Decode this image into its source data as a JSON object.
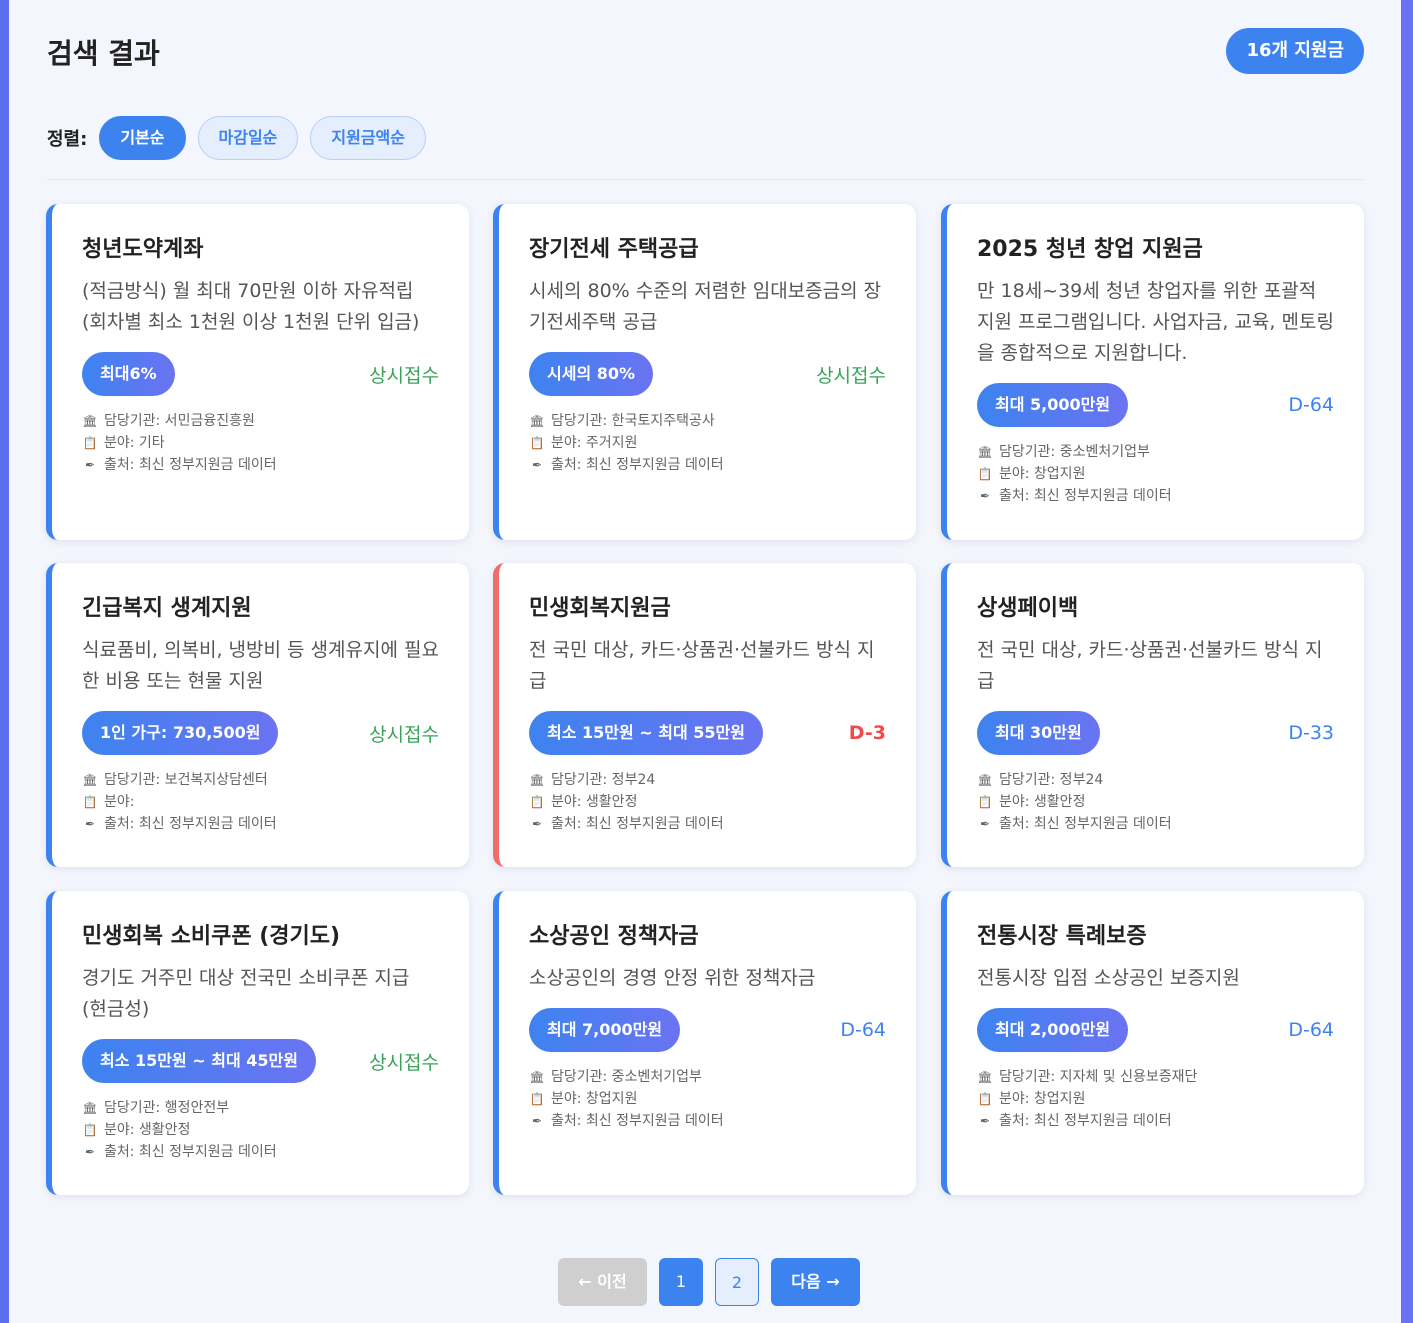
{
  "header": {
    "title": "검색 결과",
    "count_badge": "16개 지원금"
  },
  "sort": {
    "label": "정렬:",
    "options": [
      "기본순",
      "마감일순",
      "지원금액순"
    ],
    "active": "기본순"
  },
  "cards": [
    {
      "title": "청년도약계좌",
      "desc": "(적금방식) 월 최대 70만원 이하 자유적립 (회차별 최소 1천원 이상 1천원 단위 입금)",
      "amount": "최대6%",
      "deadline": "상시접수",
      "agency": "담당기관: 서민금융진흥원",
      "field": "분야: 기타",
      "source": "출처: 최신 정부지원금 데이터"
    },
    {
      "title": "장기전세 주택공급",
      "desc": "시세의 80% 수준의 저렴한 임대보증금의 장기전세주택 공급",
      "amount": "시세의 80%",
      "deadline": "상시접수",
      "agency": "담당기관: 한국토지주택공사",
      "field": "분야: 주거지원",
      "source": "출처: 최신 정부지원금 데이터"
    },
    {
      "title": "2025 청년 창업 지원금",
      "desc": "만 18세~39세 청년 창업자를 위한 포괄적 지원 프로그램입니다. 사업자금, 교육, 멘토링을 종합적으로 지원합니다.",
      "amount": "최대 5,000만원",
      "deadline": "D-64",
      "agency": "담당기관: 중소벤처기업부",
      "field": "분야: 창업지원",
      "source": "출처: 최신 정부지원금 데이터"
    },
    {
      "title": "긴급복지 생계지원",
      "desc": "식료품비, 의복비, 냉방비 등 생계유지에 필요한 비용 또는 현물 지원",
      "amount": "1인 가구: 730,500원",
      "deadline": "상시접수",
      "agency": "담당기관: 보건복지상담센터",
      "field": "분야:",
      "source": "출처: 최신 정부지원금 데이터"
    },
    {
      "title": "민생회복지원금",
      "desc": "전 국민 대상, 카드·상품권·선불카드 방식 지급",
      "amount": "최소 15만원 ~ 최대 55만원",
      "deadline": "D-3",
      "agency": "담당기관: 정부24",
      "field": "분야: 생활안정",
      "source": "출처: 최신 정부지원금 데이터"
    },
    {
      "title": "상생페이백",
      "desc": "전 국민 대상, 카드·상품권·선불카드 방식 지급",
      "amount": "최대 30만원",
      "deadline": "D-33",
      "agency": "담당기관: 정부24",
      "field": "분야: 생활안정",
      "source": "출처: 최신 정부지원금 데이터"
    },
    {
      "title": "민생회복 소비쿠폰 (경기도)",
      "desc": "경기도 거주민 대상 전국민 소비쿠폰 지급 (현금성)",
      "amount": "최소 15만원 ~ 최대 45만원",
      "deadline": "상시접수",
      "agency": "담당기관: 행정안전부",
      "field": "분야: 생활안정",
      "source": "출처: 최신 정부지원금 데이터"
    },
    {
      "title": "소상공인 정책자금",
      "desc": "소상공인의 경영 안정 위한 정책자금",
      "amount": "최대 7,000만원",
      "deadline": "D-64",
      "agency": "담당기관: 중소벤처기업부",
      "field": "분야: 창업지원",
      "source": "출처: 최신 정부지원금 데이터"
    },
    {
      "title": "전통시장 특례보증",
      "desc": "전통시장 입점 소상공인 보증지원",
      "amount": "최대 2,000만원",
      "deadline": "D-64",
      "agency": "담당기관: 지자체 및 신용보증재단",
      "field": "분야: 창업지원",
      "source": "출처: 최신 정부지원금 데이터"
    }
  ],
  "icons": {
    "agency": "bank-icon",
    "field": "clipboard-icon",
    "source": "pen-icon"
  },
  "colors": {
    "accent": "#3d83f0",
    "open": "#3aa35a",
    "urgent": "#ef4b4b",
    "urgent_border": "#f26b6b"
  },
  "pagination": {
    "prev": "← 이전",
    "pages": [
      "1",
      "2"
    ],
    "current": "1",
    "next": "다음 →"
  }
}
